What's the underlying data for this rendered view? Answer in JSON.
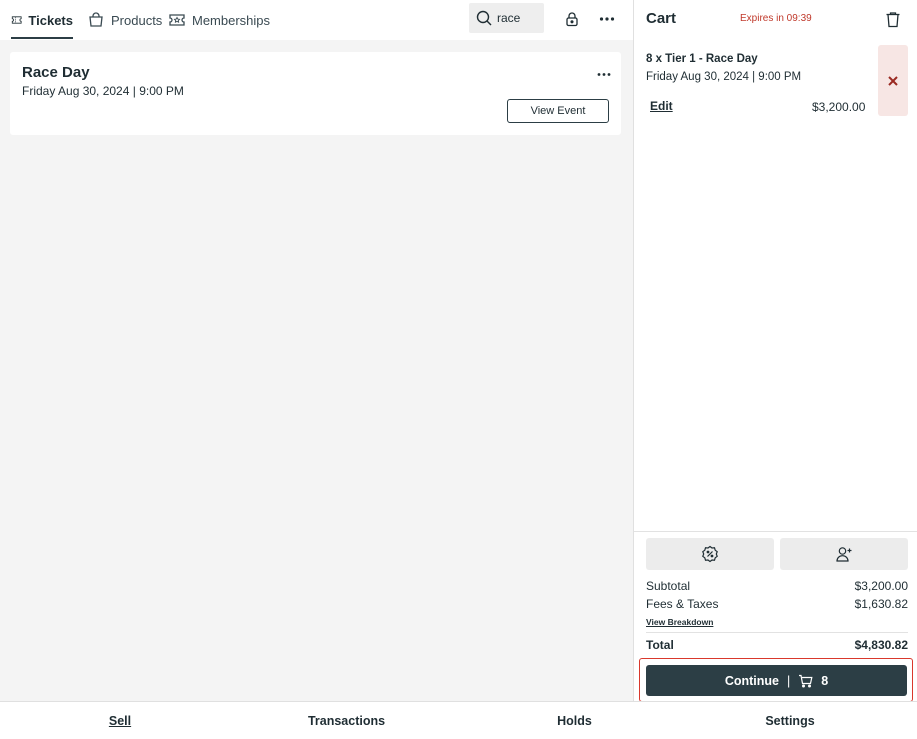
{
  "tabs": [
    {
      "label": "Tickets",
      "icon": "ticket-icon",
      "active": true
    },
    {
      "label": "Products",
      "icon": "bag-icon",
      "active": false
    },
    {
      "label": "Memberships",
      "icon": "membership-icon",
      "active": false
    }
  ],
  "search": {
    "value": "race"
  },
  "event": {
    "title": "Race Day",
    "date": "Friday Aug 30, 2024 | 9:00 PM",
    "view_button": "View Event"
  },
  "cart": {
    "title": "Cart",
    "expires": "Expires in 09:39",
    "item": {
      "title": "8 x Tier 1 - Race Day",
      "date": "Friday Aug 30, 2024 | 9:00 PM",
      "edit_label": "Edit",
      "price": "$3,200.00"
    },
    "subtotal_label": "Subtotal",
    "subtotal_value": "$3,200.00",
    "fees_label": "Fees & Taxes",
    "fees_value": "$1,630.82",
    "breakdown_label": "View Breakdown",
    "total_label": "Total",
    "total_value": "$4,830.82",
    "continue_label": "Continue",
    "continue_sep": "|",
    "cart_count": "8"
  },
  "bottom_nav": [
    {
      "label": "Sell",
      "active": true
    },
    {
      "label": "Transactions",
      "active": false
    },
    {
      "label": "Holds",
      "active": false
    },
    {
      "label": "Settings",
      "active": false
    }
  ],
  "colors": {
    "accent": "#2c3e45",
    "danger": "#c0392b",
    "highlight": "#d9382c"
  }
}
